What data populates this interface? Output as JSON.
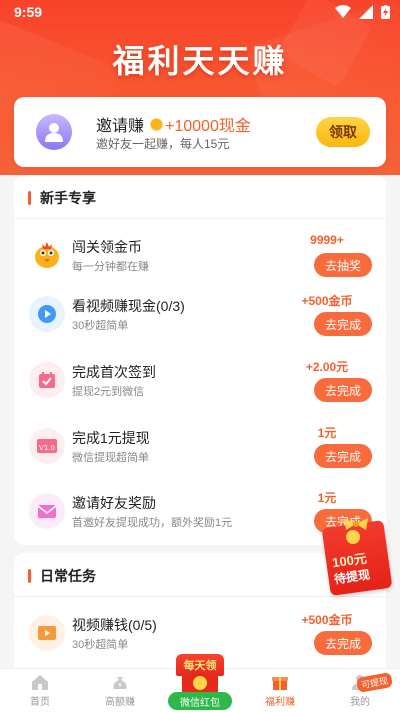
{
  "status": {
    "time": "9:59"
  },
  "header": {
    "title": "福利天天赚"
  },
  "invite": {
    "title": "邀请赚",
    "reward": "+10000现金",
    "subtitle": "邀好友一起赚，每人15元",
    "button": "领取"
  },
  "newbie": {
    "title": "新手专享",
    "tasks": [
      {
        "name": "闯关领金币",
        "desc": "每一分钟都在赚",
        "reward": "9999+",
        "button": "去抽奖",
        "icon": "chick-mascot-icon"
      },
      {
        "name": "看视频赚现金(0/3)",
        "desc": "30秒超简单",
        "reward": "+500金币",
        "button": "去完成",
        "icon": "play-video-icon"
      },
      {
        "name": "完成首次签到",
        "desc": "提现2元到微信",
        "reward": "+2.00元",
        "button": "去完成",
        "icon": "calendar-check-icon"
      },
      {
        "name": "完成1元提现",
        "desc": "微信提现超简单",
        "reward": "1元",
        "button": "去完成",
        "icon": "withdraw-ticket-icon"
      },
      {
        "name": "邀请好友奖励",
        "desc": "首邀好友提现成功，额外奖励1元",
        "reward": "1元",
        "button": "去完成",
        "icon": "envelope-icon"
      }
    ]
  },
  "daily": {
    "title": "日常任务",
    "tasks": [
      {
        "name": "视频赚钱(0/5)",
        "desc": "30秒超简单",
        "reward": "+500金币",
        "button": "去完成",
        "icon": "video-icon"
      }
    ]
  },
  "floating_pack": {
    "amount": "100元",
    "text": "待提现"
  },
  "bottom_nav": {
    "items": [
      {
        "label": "首页",
        "icon": "home-icon"
      },
      {
        "label": "高额赚",
        "icon": "money-bag-icon"
      },
      {
        "label": "",
        "icon": "red-packet-icon"
      },
      {
        "label": "福利赚",
        "icon": "gift-icon"
      },
      {
        "label": "我的",
        "icon": "user-icon"
      }
    ],
    "center": {
      "top": "每天领",
      "label": "微信红包"
    },
    "mine_badge": "可提现"
  },
  "colors": {
    "primary": "#f5602d",
    "header": "#f8432b",
    "gold": "#fbb70e"
  }
}
